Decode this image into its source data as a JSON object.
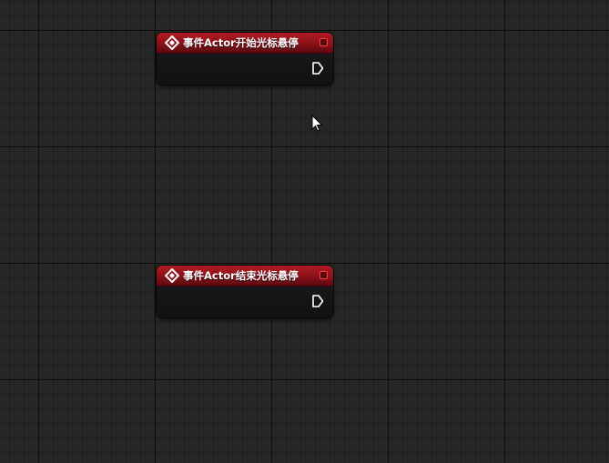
{
  "graph": {
    "background_color": "#262626",
    "header_color": "#8a1119",
    "delegate_pin_color": "#ff3b3b"
  },
  "nodes": [
    {
      "title": "事件Actor开始光标悬停",
      "icon": "event-diamond-icon",
      "output_pin": "exec-out-pin-icon",
      "delegate_pin": "delegate-pin-icon"
    },
    {
      "title": "事件Actor结束光标悬停",
      "icon": "event-diamond-icon",
      "output_pin": "exec-out-pin-icon",
      "delegate_pin": "delegate-pin-icon"
    }
  ],
  "cursor": {
    "icon": "mouse-pointer-icon"
  }
}
